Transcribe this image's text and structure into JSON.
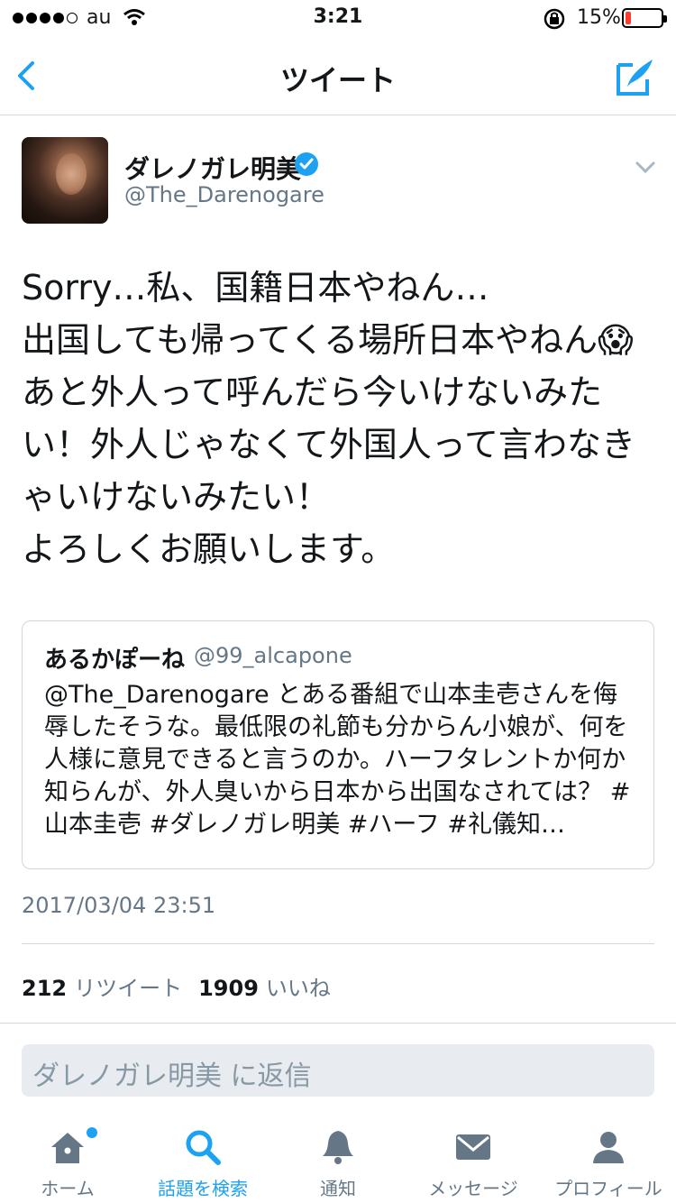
{
  "status_bar": {
    "carrier": "au",
    "time": "3:21",
    "battery": "15%"
  },
  "nav": {
    "title": "ツイート"
  },
  "tweet": {
    "display_name": "ダレノガレ明美",
    "handle": "@The_Darenogare",
    "text": "Sorry…私、国籍日本やねん…\n出国しても帰ってくる場所日本やねん😱あと外人って呼んだら今いけないみたい！外人じゃなくて外国人って言わなきゃいけないみたい！\nよろしくお願いします。",
    "timestamp": "2017/03/04 23:51",
    "retweets": "212",
    "retweets_label": "リツイート",
    "likes": "1909",
    "likes_label": "いいね"
  },
  "quoted": {
    "name": "あるかぽーね",
    "handle": "@99_alcapone",
    "text": "@The_Darenogare とある番組で山本圭壱さんを侮辱したそうな。最低限の礼節も分からん小娘が、何を人様に意見できると言うのか。ハーフタレントか何か知らんが、外人臭いから日本から出国なされては？ #山本圭壱 #ダレノガレ明美 #ハーフ #礼儀知…"
  },
  "reply": {
    "placeholder": "ダレノガレ明美 に返信"
  },
  "tabs": [
    {
      "label": "ホーム",
      "icon": "home-icon"
    },
    {
      "label": "話題を検索",
      "icon": "search-icon"
    },
    {
      "label": "通知",
      "icon": "bell-icon"
    },
    {
      "label": "メッセージ",
      "icon": "envelope-icon"
    },
    {
      "label": "プロフィール",
      "icon": "person-icon"
    }
  ],
  "colors": {
    "accent": "#1da1f2",
    "secondary_text": "#657786",
    "battery_low": "#ff3b30"
  }
}
